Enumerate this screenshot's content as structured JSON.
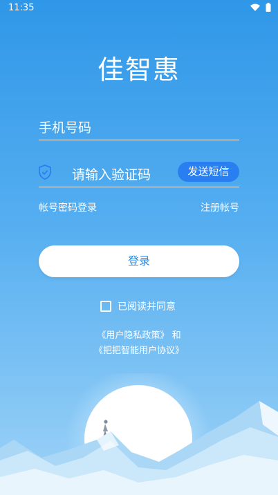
{
  "status": {
    "time": "11:35",
    "wifi_icon": "wifi-icon",
    "battery_icon": "battery-icon"
  },
  "app": {
    "title": "佳智惠"
  },
  "form": {
    "phone_placeholder": "手机号码",
    "code_placeholder": "请输入验证码",
    "send_sms_label": "发送短信",
    "password_login_link": "帐号密码登录",
    "register_link": "注册帐号",
    "login_label": "登录"
  },
  "agreement": {
    "checked": false,
    "label": "已阅读并同意",
    "privacy_policy": "《用户隐私政策》",
    "conjunction": "和",
    "user_agreement": "《把把智能用户协议》"
  },
  "colors": {
    "accent": "#2a7ff0",
    "background_top": "#2f97e8"
  }
}
